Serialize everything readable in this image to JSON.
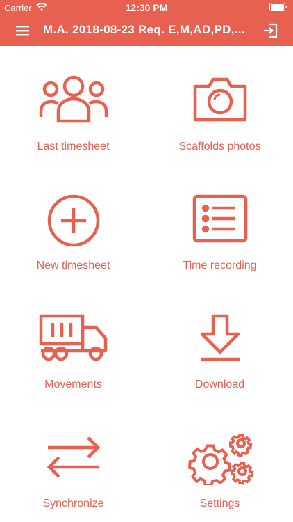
{
  "status_bar": {
    "carrier": "Carrier",
    "time": "12:30 PM"
  },
  "navbar": {
    "title": "M.A. 2018-08-23 Req. E,M,AD,PD,...",
    "menu_icon": "hamburger-menu-icon",
    "logout_icon": "logout-icon"
  },
  "accent_color": "#e8604f",
  "menu": [
    {
      "label": "Last timesheet",
      "icon": "users-group-icon"
    },
    {
      "label": "Scaffolds photos",
      "icon": "camera-icon"
    },
    {
      "label": "New timesheet",
      "icon": "plus-circle-icon"
    },
    {
      "label": "Time recording",
      "icon": "list-icon"
    },
    {
      "label": "Movements",
      "icon": "truck-icon"
    },
    {
      "label": "Download",
      "icon": "download-icon"
    },
    {
      "label": "Synchronize",
      "icon": "sync-arrows-icon"
    },
    {
      "label": "Settings",
      "icon": "gears-icon"
    }
  ]
}
